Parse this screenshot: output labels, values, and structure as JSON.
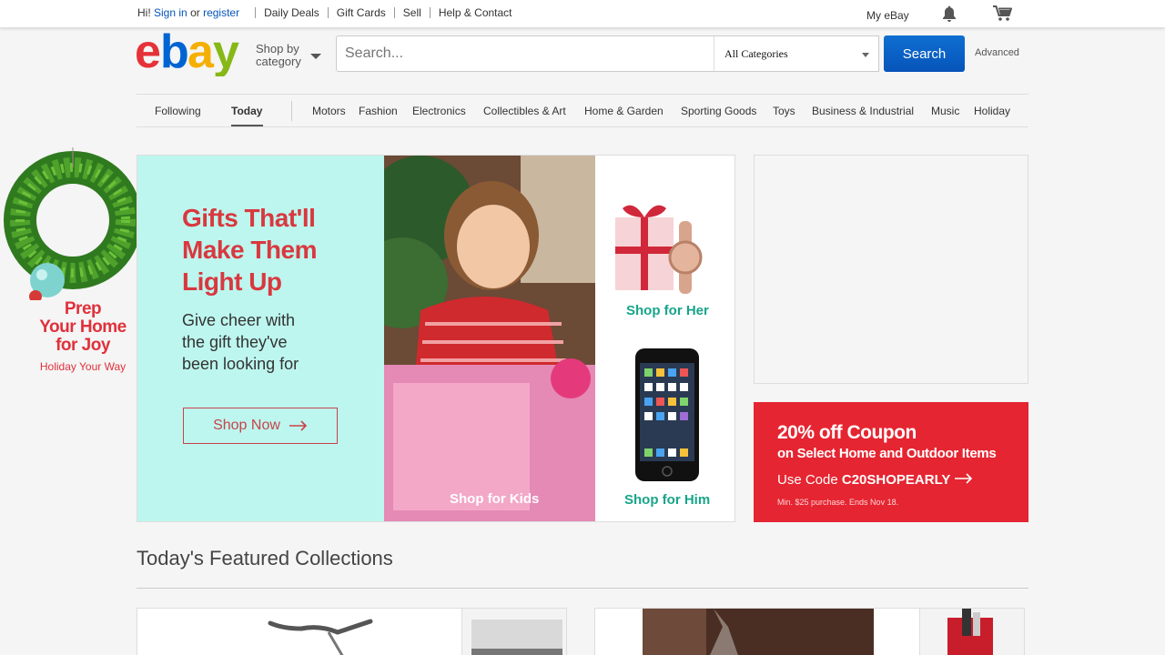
{
  "topbar": {
    "greeting": "Hi!",
    "sign_in": "Sign in",
    "or": "or",
    "register": "register",
    "links": [
      "Daily Deals",
      "Gift Cards",
      "Sell",
      "Help & Contact"
    ],
    "my_ebay": "My eBay",
    "bell_icon": "bell-icon",
    "cart_icon": "cart-icon"
  },
  "header": {
    "shop_by_line1": "Shop by",
    "shop_by_line2": "category",
    "search_placeholder": "Search...",
    "category_selected": "All Categories",
    "search_button": "Search",
    "advanced": "Advanced"
  },
  "nav": {
    "items": [
      "Following",
      "Today",
      "Motors",
      "Fashion",
      "Electronics",
      "Collectibles & Art",
      "Home & Garden",
      "Sporting Goods",
      "Toys",
      "Business & Industrial",
      "Music",
      "Holiday"
    ],
    "active": "Today"
  },
  "left_promo": {
    "line1": "Prep",
    "line2": "Your Home",
    "line3": "for Joy",
    "tagline": "Holiday Your Way"
  },
  "hero": {
    "headline_1": "Gifts That'll",
    "headline_2": "Make Them",
    "headline_3": "Light Up",
    "sub_1": "Give cheer with",
    "sub_2": "the gift they've",
    "sub_3": "been looking for",
    "cta": "Shop Now",
    "shop_kids": "Shop for Kids",
    "shop_her": "Shop for Her",
    "shop_him": "Shop for Him"
  },
  "coupon": {
    "title": "20% off Coupon",
    "subtitle": "on Select Home and Outdoor Items",
    "code_prefix": "Use Code",
    "code": "C20SHOPEARLY",
    "fineprint": "Min. $25 purchase. Ends Nov 18."
  },
  "featured": {
    "title": "Today's Featured Collections"
  },
  "colors": {
    "link_blue": "#0654ba",
    "promo_red": "#d9383f",
    "mint": "#bdf6ee",
    "teal_label": "#17a589",
    "coupon_red": "#e52531"
  }
}
